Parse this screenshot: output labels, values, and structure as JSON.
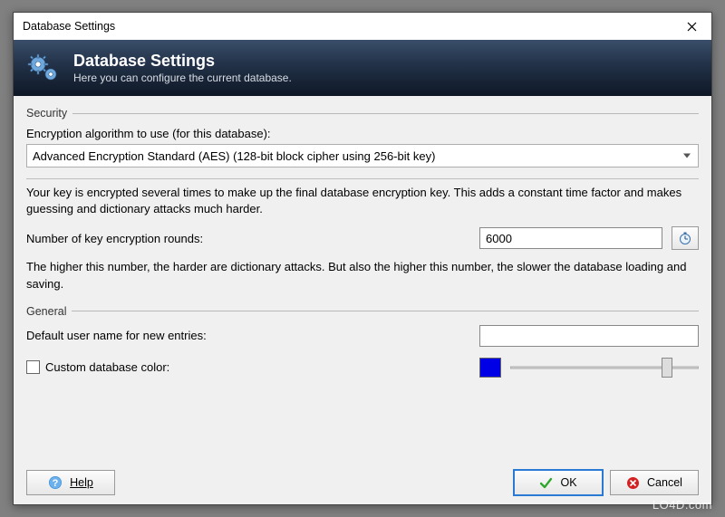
{
  "window": {
    "title": "Database Settings"
  },
  "header": {
    "title": "Database Settings",
    "subtitle": "Here you can configure the current database."
  },
  "security": {
    "group_label": "Security",
    "algo_label": "Encryption algorithm to use (for this database):",
    "algo_value": "Advanced Encryption Standard (AES) (128-bit block cipher using 256-bit key)",
    "key_info": "Your key is encrypted several times to make up the final database encryption key. This adds a constant time factor and makes guessing and dictionary attacks much harder.",
    "rounds_label": "Number of key encryption rounds:",
    "rounds_value": "6000",
    "rounds_note": "The higher this number, the harder are dictionary attacks. But also the higher this number, the slower the database loading and saving."
  },
  "general": {
    "group_label": "General",
    "username_label": "Default user name for new entries:",
    "username_value": "",
    "custom_color_label": "Custom database color:",
    "custom_color_checked": false,
    "color_hex": "#0000e6",
    "slider_pos_percent": 83
  },
  "buttons": {
    "help": "Help",
    "ok": "OK",
    "cancel": "Cancel"
  },
  "watermark": "LO4D.com"
}
